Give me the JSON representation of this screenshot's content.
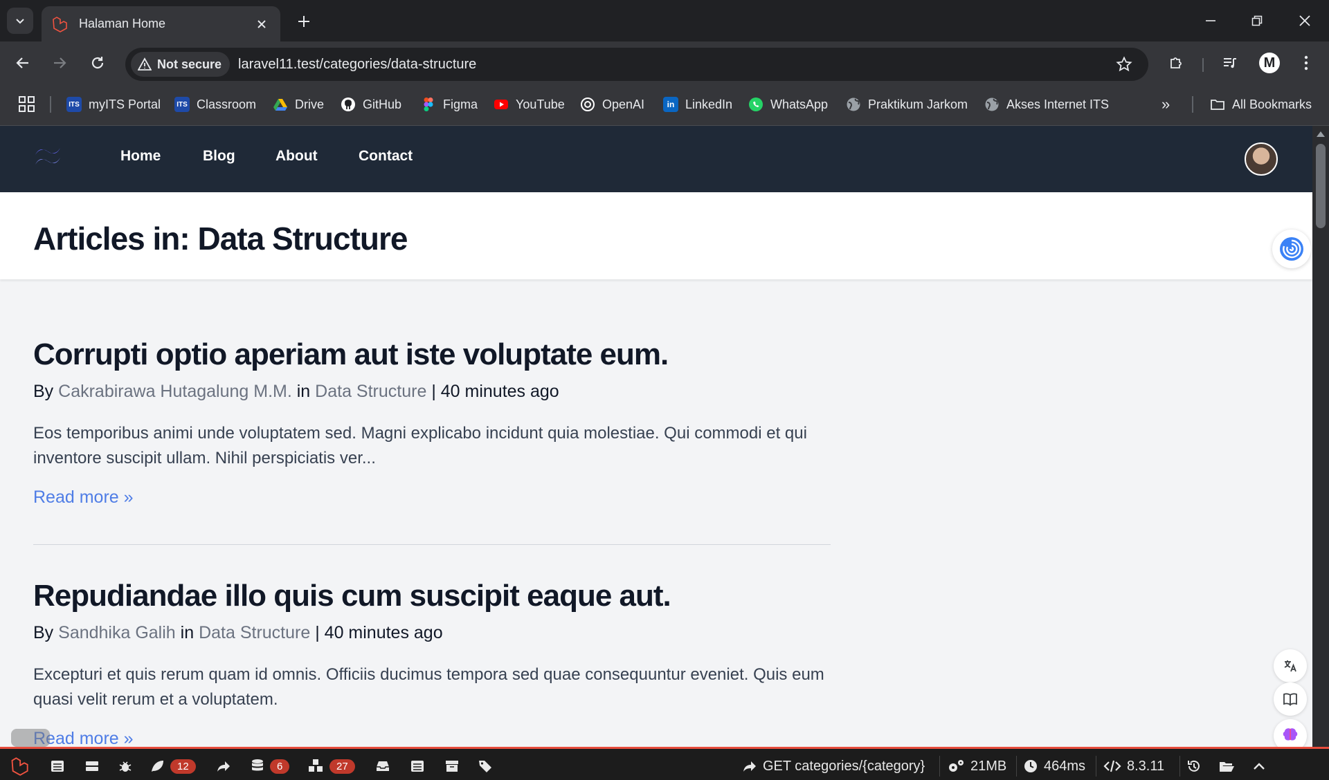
{
  "browser": {
    "tab_title": "Halaman Home",
    "url_security_label": "Not secure",
    "url": "laravel11.test/categories/data-structure",
    "profile_initial": "M"
  },
  "bookmarks": {
    "items": [
      {
        "label": "myITS Portal",
        "icon": "its-icon",
        "color": "#1e4aa8"
      },
      {
        "label": "Classroom",
        "icon": "its-icon",
        "color": "#1e4aa8"
      },
      {
        "label": "Drive",
        "icon": "google-drive-icon",
        "color": "#34a853"
      },
      {
        "label": "GitHub",
        "icon": "github-icon",
        "color": "#ffffff"
      },
      {
        "label": "Figma",
        "icon": "figma-icon",
        "color": "#f24e1e"
      },
      {
        "label": "YouTube",
        "icon": "youtube-icon",
        "color": "#ff0000"
      },
      {
        "label": "OpenAI",
        "icon": "openai-icon",
        "color": "#ffffff"
      },
      {
        "label": "LinkedIn",
        "icon": "linkedin-icon",
        "color": "#0a66c2"
      },
      {
        "label": "WhatsApp",
        "icon": "whatsapp-icon",
        "color": "#25d366"
      },
      {
        "label": "Praktikum Jarkom",
        "icon": "globe-icon",
        "color": "#9aa0a6"
      },
      {
        "label": "Akses Internet ITS",
        "icon": "globe-icon",
        "color": "#9aa0a6"
      }
    ],
    "overflow": "»",
    "all_bookmarks": "All Bookmarks"
  },
  "site": {
    "nav": [
      "Home",
      "Blog",
      "About",
      "Contact"
    ],
    "page_title": "Articles in: Data Structure"
  },
  "articles": [
    {
      "title": "Corrupti optio aperiam aut iste voluptate eum.",
      "by": "By",
      "author": "Cakrabirawa Hutagalung M.M.",
      "in": "in",
      "category": "Data Structure",
      "time": "| 40 minutes ago",
      "excerpt": "Eos temporibus animi unde voluptatem sed. Magni explicabo incidunt quia molestiae. Qui commodi et qui inventore suscipit ullam. Nihil perspiciatis ver...",
      "read_more": "Read more »"
    },
    {
      "title": "Repudiandae illo quis cum suscipit eaque aut.",
      "by": "By",
      "author": "Sandhika Galih",
      "in": "in",
      "category": "Data Structure",
      "time": "| 40 minutes ago",
      "excerpt": "Excepturi et quis rerum quam id omnis. Officiis ducimus tempora sed quae consequuntur eveniet. Quis eum quasi velit rerum et a voluptatem.",
      "read_more": "Read more »"
    }
  ],
  "debugbar": {
    "accent": "#e74c3c",
    "views_count": "12",
    "queries_count": "6",
    "models_count": "27",
    "route": "GET categories/{category}",
    "memory": "21MB",
    "time": "464ms",
    "php_version": "8.3.11"
  }
}
